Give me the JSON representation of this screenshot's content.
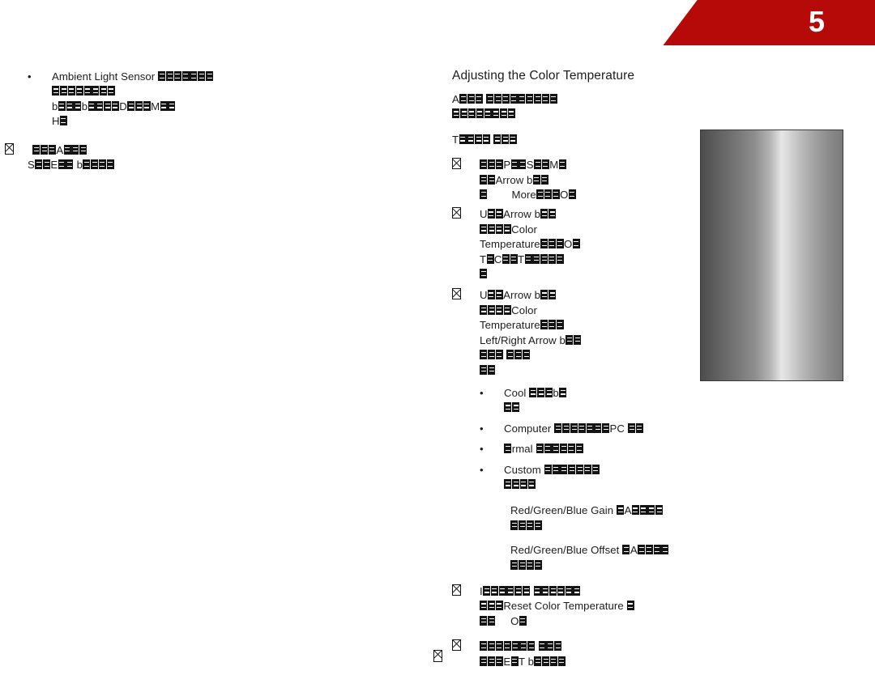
{
  "page": {
    "chapter_number": "5",
    "banner_color": "#b50a07",
    "footer_page_number": "□"
  },
  "left_column": {
    "items": [
      {
        "marker": "•",
        "lines": [
          "Ambient Light Sensor □□□□□□□",
          "□□□□□□□□",
          "b□□□b□□□□D□□□M□□",
          "H□"
        ]
      },
      {
        "marker": "□",
        "lines": [
          "□□□A□□□",
          "S□□E□□ b□□□□"
        ]
      }
    ]
  },
  "right_column": {
    "heading": "Adjusting the Color Temperature",
    "intro_lines": [
      "A□□□ □□□□□□□□□",
      "□□□□□□□□"
    ],
    "sub_intro": "T□□□□ □□□",
    "steps": [
      {
        "marker": "□",
        "lines": [
          "□□□P□□S□□M□",
          "□□Arrow b□□",
          "□        More□□□O□"
        ]
      },
      {
        "marker": "□",
        "lines": [
          "U□□Arrow b□□",
          "□□□□Color",
          "Temperature□□□O□",
          "T□C□□T□□□□□",
          "□"
        ]
      },
      {
        "marker": "□",
        "lines": [
          "U□□Arrow b□□",
          "□□□□Color",
          "Temperature□□□",
          "Left/Right Arrow b□□",
          "□□□ □□□",
          "□□"
        ],
        "bullets": [
          {
            "marker": "•",
            "lines": [
              "Cool □□□b□",
              "□□"
            ]
          },
          {
            "marker": "•",
            "lines": [
              "Computer □□□□□□□PC □□"
            ]
          },
          {
            "marker": "•",
            "lines": [
              "□rmal □□□□□□"
            ]
          },
          {
            "marker": "•",
            "lines": [
              "Custom □□□□□□□",
              "□□□□"
            ]
          }
        ],
        "sub_blocks": [
          {
            "lines": [
              "Red/Green/Blue Gain □A□□□□",
              "□□□□"
            ]
          },
          {
            "lines": [
              "Red/Green/Blue Offset □A□□□□",
              "□□□□"
            ]
          }
        ]
      },
      {
        "marker": "□",
        "lines": [
          "I□□□□□□ □□□□□□",
          "□□□Reset Color Temperature □",
          "□□     O□"
        ]
      },
      {
        "marker": "□",
        "lines": [
          "□□□□□□□ □□□",
          "□□□E□T b□□□□"
        ]
      }
    ]
  },
  "figure": {
    "name": "color-temperature-gradient-bar",
    "description": "grayscale gradient sample bar"
  }
}
